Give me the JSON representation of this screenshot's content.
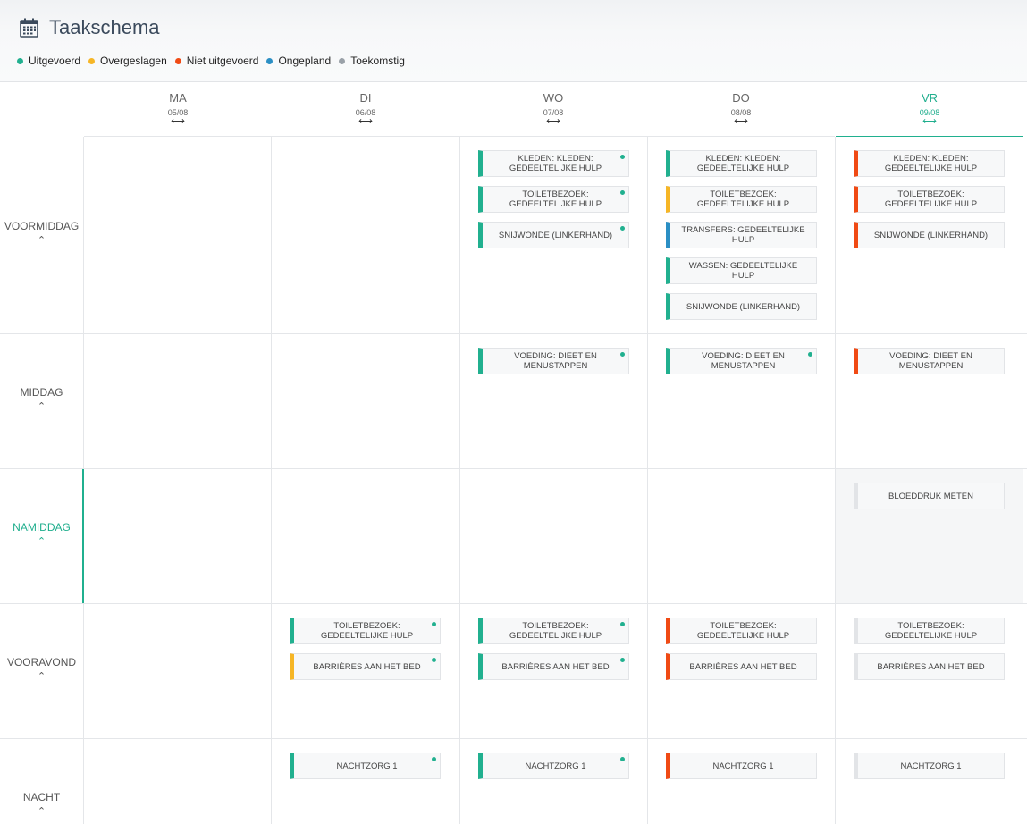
{
  "header": {
    "title": "Taakschema",
    "icon": "calendar-icon"
  },
  "legend": [
    {
      "label": "Uitgevoerd",
      "color": "#21b08f"
    },
    {
      "label": "Overgeslagen",
      "color": "#f6b626"
    },
    {
      "label": "Niet uitgevoerd",
      "color": "#f04a14"
    },
    {
      "label": "Ongepland",
      "color": "#2b8fc4"
    },
    {
      "label": "Toekomstig",
      "color": "#9aa1a8"
    }
  ],
  "days": [
    {
      "name": "MA",
      "date": "05/08",
      "arrow": "⟷"
    },
    {
      "name": "DI",
      "date": "06/08",
      "arrow": "⟷"
    },
    {
      "name": "WO",
      "date": "07/08",
      "arrow": "⟷"
    },
    {
      "name": "DO",
      "date": "08/08",
      "arrow": "⟷"
    },
    {
      "name": "VR",
      "date": "09/08",
      "arrow": "⟷"
    }
  ],
  "periods": [
    {
      "name": "VOORMIDDAG",
      "chevron": "⌃"
    },
    {
      "name": "MIDDAG",
      "chevron": "⌃"
    },
    {
      "name": "NAMIDDAG",
      "chevron": "⌃"
    },
    {
      "name": "VOORAVOND",
      "chevron": "⌃"
    },
    {
      "name": "NACHT",
      "chevron": "⌃"
    }
  ],
  "tasks": {
    "wo_voormiddag_1": {
      "label": "KLEDEN: KLEDEN: GEDEELTELIJKE HULP",
      "status": "Uitgevoerd"
    },
    "wo_voormiddag_2": {
      "label": "TOILETBEZOEK: GEDEELTELIJKE HULP",
      "status": "Uitgevoerd"
    },
    "wo_voormiddag_3": {
      "label": "SNIJWONDE (LINKERHAND)",
      "status": "Uitgevoerd"
    },
    "do_voormiddag_1": {
      "label": "KLEDEN: KLEDEN: GEDEELTELIJKE HULP",
      "status": "Uitgevoerd"
    },
    "do_voormiddag_2": {
      "label": "TOILETBEZOEK: GEDEELTELIJKE HULP",
      "status": "Overgeslagen"
    },
    "do_voormiddag_3": {
      "label": "TRANSFERS: GEDEELTELIJKE HULP",
      "status": "Ongepland"
    },
    "do_voormiddag_4": {
      "label": "WASSEN: GEDEELTELIJKE HULP",
      "status": "Uitgevoerd"
    },
    "do_voormiddag_5": {
      "label": "SNIJWONDE (LINKERHAND)",
      "status": "Uitgevoerd"
    },
    "vr_voormiddag_1": {
      "label": "KLEDEN: KLEDEN: GEDEELTELIJKE HULP",
      "status": "Niet uitgevoerd"
    },
    "vr_voormiddag_2": {
      "label": "TOILETBEZOEK: GEDEELTELIJKE HULP",
      "status": "Niet uitgevoerd"
    },
    "vr_voormiddag_3": {
      "label": "SNIJWONDE (LINKERHAND)",
      "status": "Niet uitgevoerd"
    },
    "wo_middag_1": {
      "label": "VOEDING: DIEET EN MENUSTAPPEN",
      "status": "Uitgevoerd"
    },
    "do_middag_1": {
      "label": "VOEDING: DIEET EN MENUSTAPPEN",
      "status": "Uitgevoerd"
    },
    "vr_middag_1": {
      "label": "VOEDING: DIEET EN MENUSTAPPEN",
      "status": "Niet uitgevoerd"
    },
    "vr_namiddag_1": {
      "label": "BLOEDDRUK METEN",
      "status": "Toekomstig"
    },
    "di_vooravond_1": {
      "label": "TOILETBEZOEK: GEDEELTELIJKE HULP",
      "status": "Uitgevoerd"
    },
    "di_vooravond_2": {
      "label": "BARRIÈRES AAN HET BED",
      "status": "Overgeslagen"
    },
    "wo_vooravond_1": {
      "label": "TOILETBEZOEK: GEDEELTELIJKE HULP",
      "status": "Uitgevoerd"
    },
    "wo_vooravond_2": {
      "label": "BARRIÈRES AAN HET BED",
      "status": "Uitgevoerd"
    },
    "do_vooravond_1": {
      "label": "TOILETBEZOEK: GEDEELTELIJKE HULP",
      "status": "Niet uitgevoerd"
    },
    "do_vooravond_2": {
      "label": "BARRIÈRES AAN HET BED",
      "status": "Niet uitgevoerd"
    },
    "vr_vooravond_1": {
      "label": "TOILETBEZOEK: GEDEELTELIJKE HULP",
      "status": "Toekomstig"
    },
    "vr_vooravond_2": {
      "label": "BARRIÈRES AAN HET BED",
      "status": "Toekomstig"
    },
    "di_nacht_1": {
      "label": "NACHTZORG 1",
      "status": "Uitgevoerd"
    },
    "wo_nacht_1": {
      "label": "NACHTZORG 1",
      "status": "Uitgevoerd"
    },
    "do_nacht_1": {
      "label": "NACHTZORG 1",
      "status": "Niet uitgevoerd"
    },
    "vr_nacht_1": {
      "label": "NACHTZORG 1",
      "status": "Toekomstig"
    }
  }
}
